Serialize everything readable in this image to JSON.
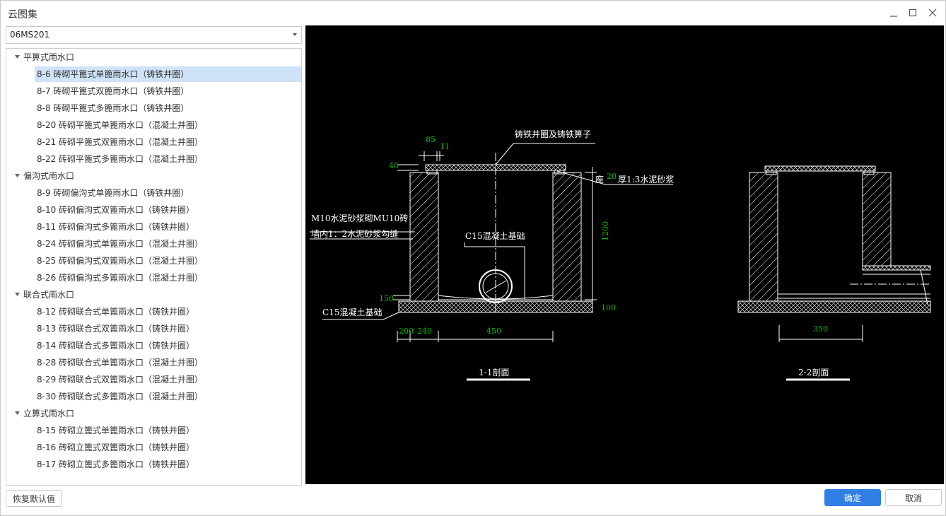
{
  "window": {
    "title": "云图集"
  },
  "atlas_select": {
    "value": "06MS201"
  },
  "tree": {
    "groups": [
      {
        "label": "平箅式雨水口",
        "items": [
          "8-6 砖砌平篦式单篦雨水口（铸铁井圈）",
          "8-7 砖砌平篦式双篦雨水口（铸铁井圈）",
          "8-8 砖砌平篦式多篦雨水口（铸铁井圈）",
          "8-20 砖砌平篦式单篦雨水口（混凝土井圈）",
          "8-21 砖砌平篦式双篦雨水口（混凝土井圈）",
          "8-22 砖砌平篦式多篦雨水口（混凝土井圈）"
        ]
      },
      {
        "label": "偏沟式雨水口",
        "items": [
          "8-9 砖砌偏沟式单篦雨水口（铸铁井圈）",
          "8-10 砖砌偏沟式双篦雨水口（铸铁井圈）",
          "8-11 砖砌偏沟式多篦雨水口（铸铁井圈）",
          "8-24 砖砌偏沟式单篦雨水口（混凝土井圈）",
          "8-25 砖砌偏沟式双篦雨水口（混凝土井圈）",
          "8-26 砖砌偏沟式多篦雨水口（混凝土井圈）"
        ]
      },
      {
        "label": "联合式雨水口",
        "items": [
          "8-12 砖砌联合式单篦雨水口（铸铁井圈）",
          "8-13 砖砌联合式双篦雨水口（铸铁井圈）",
          "8-14 砖砌联合式多篦雨水口（铸铁井圈）",
          "8-28 砖砌联合式单篦雨水口（混凝土井圈）",
          "8-29 砖砌联合式双篦雨水口（混凝土井圈）",
          "8-30 砖砌联合式多篦雨水口（混凝土井圈）"
        ]
      },
      {
        "label": "立箅式雨水口",
        "items": [
          "8-15 砖砌立篦式单篦雨水口（铸铁井圈）",
          "8-16 砖砌立篦式双篦雨水口（铸铁井圈）",
          "8-17 砖砌立篦式多篦雨水口（铸铁井圈）"
        ]
      }
    ],
    "selected_item": "8-6 砖砌平篦式单篦雨水口（铸铁井圈）"
  },
  "drawing": {
    "labels": {
      "grate": "铸铁井圈及铸铁箅子",
      "mortar_seat": "座",
      "mortar_spec": "厚1:3水泥砂浆",
      "wall_line1": "M10水泥砂浆砌MU10砖",
      "wall_line2": "墙内1：2水泥砂浆勾缝",
      "c15_inner": "C15混凝土基础",
      "c15_base": "C15混凝土基础",
      "section_1": "1-1剖面",
      "section_2": "2-2剖面"
    },
    "dims": {
      "d85": "85",
      "d11": "11",
      "d40": "40",
      "d20": "20",
      "d1200": "1200",
      "d150": "150",
      "d100": "100",
      "d200": "200",
      "d240": "240",
      "d450": "450",
      "d350": "350"
    },
    "colors": {
      "background": "#000000",
      "line": "#ffffff",
      "dimension": "#00c000"
    }
  },
  "buttons": {
    "reset": "恢复默认值",
    "ok": "确定",
    "cancel": "取消"
  },
  "icons": {
    "minimize": "minimize-icon",
    "maximize": "maximize-icon",
    "close": "close-icon",
    "dropdown": "caret-down-icon",
    "expand": "triangle-down-icon"
  },
  "colors": {
    "accent": "#2f7fe4",
    "selected_row": "#cfe3f8"
  }
}
